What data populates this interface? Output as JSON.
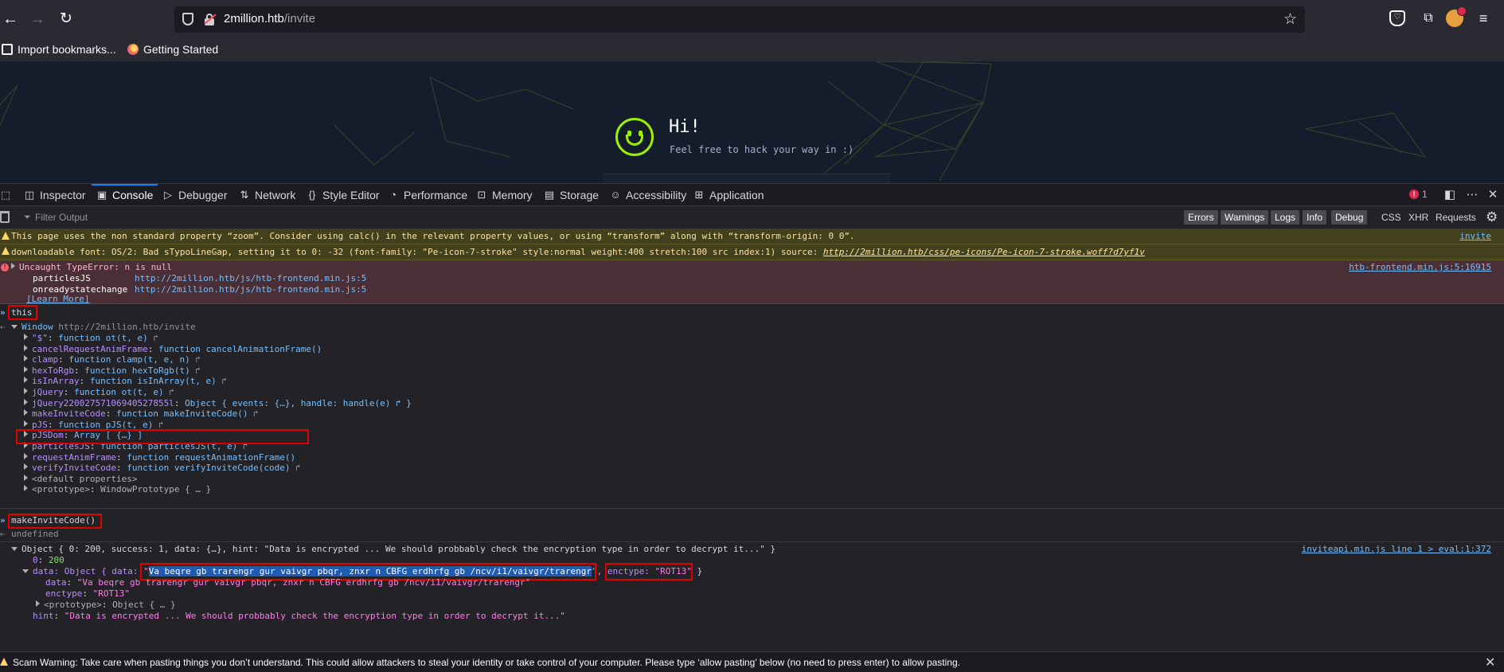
{
  "browser": {
    "url_host": "2million.htb",
    "url_path": "/invite",
    "bookmarks": [
      {
        "label": "Import bookmarks..."
      },
      {
        "label": "Getting Started"
      }
    ]
  },
  "page": {
    "title": "Hi!",
    "subtitle": "Feel free to hack your way in :)"
  },
  "devtools": {
    "tabs": [
      {
        "label": "Inspector",
        "icon": "inspector-icon"
      },
      {
        "label": "Console",
        "icon": "console-icon"
      },
      {
        "label": "Debugger",
        "icon": "debugger-icon"
      },
      {
        "label": "Network",
        "icon": "network-icon"
      },
      {
        "label": "Style Editor",
        "icon": "braces-icon"
      },
      {
        "label": "Performance",
        "icon": "gauge-icon"
      },
      {
        "label": "Memory",
        "icon": "memory-icon"
      },
      {
        "label": "Storage",
        "icon": "storage-icon"
      },
      {
        "label": "Accessibility",
        "icon": "accessibility-icon"
      },
      {
        "label": "Application",
        "icon": "grid-icon"
      }
    ],
    "error_count": "1",
    "filter_placeholder": "Filter Output",
    "levels": [
      "Errors",
      "Warnings",
      "Logs",
      "Info",
      "Debug"
    ],
    "request_filters": [
      "CSS",
      "XHR",
      "Requests"
    ]
  },
  "console": {
    "warn1": "This page uses the non standard property “zoom”. Consider using calc() in the relevant property values, or using “transform” along with “transform-origin: 0 0”.",
    "warn1_loc": "invite",
    "warn2_text": "downloadable font: OS/2: Bad sTypoLineGap, setting it to 0: -32 (font-family: \"Pe-icon-7-stroke\" style:normal weight:400 stretch:100 src index:1) source: ",
    "warn2_link": "http://2million.htb/css/pe-icons/Pe-icon-7-stroke.woff?d7yf1v",
    "error_msg": "Uncaught TypeError: n is null",
    "error_loc": "htb-frontend.min.js:5:16915",
    "stack": [
      {
        "fn": "particlesJS",
        "src": "http://2million.htb/js/htb-frontend.min.js:5"
      },
      {
        "fn": "onreadystatechange",
        "src": "http://2million.htb/js/htb-frontend.min.js:5"
      }
    ],
    "learn_more": "[Learn More]",
    "input1": "this",
    "window_label": "Window",
    "window_url": "http://2million.htb/invite",
    "props": [
      {
        "key": "\"$\"",
        "val": "function ot(t, e)",
        "jump": true
      },
      {
        "key": "cancelRequestAnimFrame",
        "val": "function cancelAnimationFrame()",
        "jump": false
      },
      {
        "key": "clamp",
        "val": "function clamp(t, e, n)",
        "jump": true
      },
      {
        "key": "hexToRgb",
        "val": "function hexToRgb(t)",
        "jump": true
      },
      {
        "key": "isInArray",
        "val": "function isInArray(t, e)",
        "jump": true
      },
      {
        "key": "jQuery",
        "val": "function ot(t, e)",
        "jump": true
      },
      {
        "key": "jQuery22002757106940527855l",
        "val": "Object { events: {…}, handle: handle(e) ↱ }",
        "jump": false
      },
      {
        "key": "makeInviteCode",
        "val": "function makeInviteCode()",
        "jump": true
      },
      {
        "key": "pJS",
        "val": "function pJS(t, e)",
        "jump": true
      },
      {
        "key": "pJSDom",
        "val": "Array [ {…} ]",
        "jump": false
      },
      {
        "key": "particlesJS",
        "val": "function particlesJS(t, e)",
        "jump": true
      },
      {
        "key": "requestAnimFrame",
        "val": "function requestAnimationFrame()",
        "jump": false
      },
      {
        "key": "verifyInviteCode",
        "val": "function verifyInviteCode(code)",
        "jump": true
      },
      {
        "key": "<default properties>",
        "val": "",
        "jump": false
      },
      {
        "key": "<prototype>",
        "val": "WindowPrototype { … }",
        "jump": false
      }
    ],
    "input2": "makeInviteCode()",
    "undefined": "undefined",
    "obj_summary": "Object { 0: 200, success: 1, data: {…}, hint: \"Data is encrypted ... We should probbably check the encryption type in order to decrypt it...\" }",
    "obj_loc": "inviteapi.min.js line 1 > eval:1:372",
    "obj_0_key": "0",
    "obj_0_val": "200",
    "data_prefix": "data: Object { data: ",
    "data_quote_open": "\"",
    "data_selected": "Va beqre gb trarengr gur vaivgr pbqr, znxr n CBFG erdhrfg gb /ncv/i1/vaivgr/trarengr",
    "data_quote_close": "\",",
    "enctype_label": "enctype: ",
    "enctype_val": "\"ROT13\"",
    "data_close": " }",
    "data_key": "data",
    "data_val": "\"Va beqre gb trarengr gur vaivgr pbqr, znxr n CBFG erdhrfg gb /ncv/i1/vaivgr/trarengr\"",
    "enctype_key": "enctype",
    "enctype_val2": "\"ROT13\"",
    "proto_key": "<prototype>",
    "proto_val": "Object { … }",
    "hint_key": "hint",
    "hint_val": "\"Data is encrypted ... We should probbably check the encryption type in order to decrypt it...\""
  },
  "scam_warning": "Scam Warning: Take care when pasting things you don’t understand. This could allow attackers to steal your identity or take control of your computer. Please type ‘allow pasting’ below (no need to press enter) to allow pasting."
}
